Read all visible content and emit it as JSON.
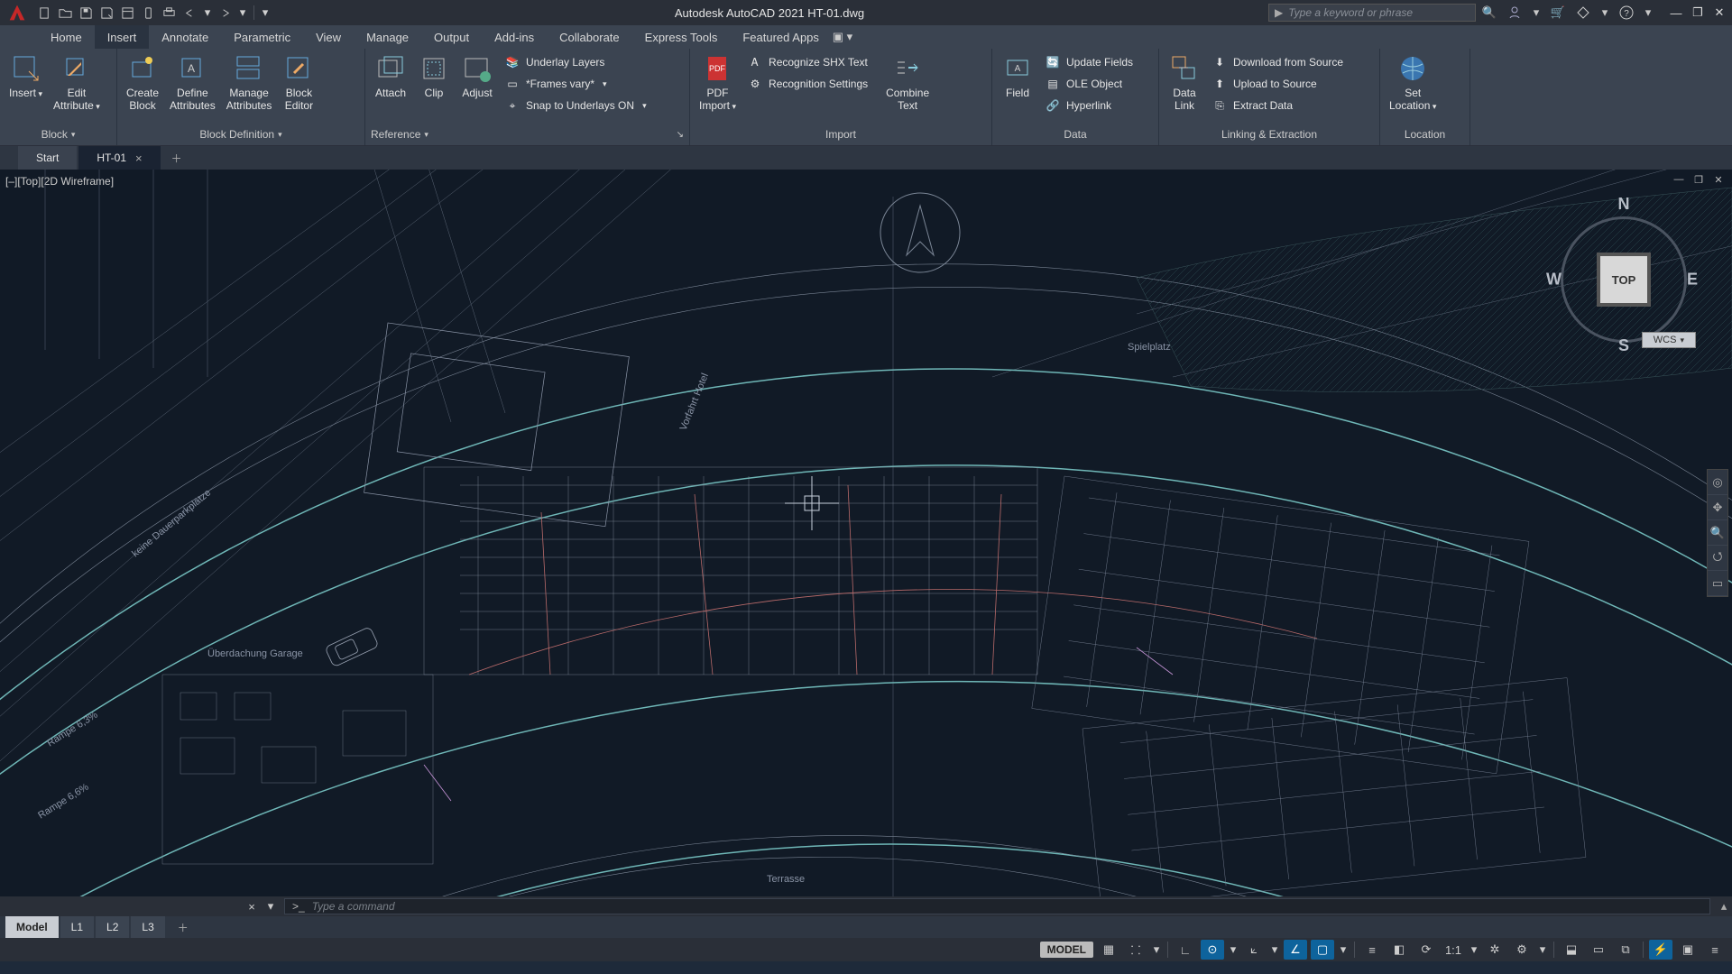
{
  "app": {
    "title": "Autodesk AutoCAD 2021   HT-01.dwg",
    "search_placeholder": "Type a keyword or phrase"
  },
  "menubar": [
    "Home",
    "Insert",
    "Annotate",
    "Parametric",
    "View",
    "Manage",
    "Output",
    "Add-ins",
    "Collaborate",
    "Express Tools",
    "Featured Apps"
  ],
  "menubar_active": "Insert",
  "ribbon": {
    "block": {
      "footer": "Block",
      "items": [
        {
          "label": "Insert",
          "dd": true
        },
        {
          "label": "Edit\nAttribute",
          "dd": true
        }
      ]
    },
    "blockdef": {
      "footer": "Block Definition",
      "items": [
        {
          "label": "Create\nBlock",
          "dd": false
        },
        {
          "label": "Define\nAttributes",
          "dd": false
        },
        {
          "label": "Manage\nAttributes",
          "dd": false
        },
        {
          "label": "Block\nEditor",
          "dd": false
        }
      ]
    },
    "reference": {
      "footer": "Reference",
      "big": [
        {
          "label": "Attach"
        },
        {
          "label": "Clip"
        },
        {
          "label": "Adjust"
        }
      ],
      "small": [
        {
          "label": "Underlay Layers"
        },
        {
          "label": "*Frames vary*",
          "dd": true
        },
        {
          "label": "Snap to Underlays ON",
          "dd": true
        }
      ]
    },
    "import": {
      "footer": "Import",
      "big": [
        {
          "label": "PDF\nImport",
          "dd": true
        }
      ],
      "small": [
        {
          "label": "Recognize SHX Text"
        },
        {
          "label": "Recognition Settings"
        }
      ],
      "combine": {
        "label": "Combine\nText"
      }
    },
    "data": {
      "footer": "Data",
      "big": [
        {
          "label": "Field"
        }
      ],
      "small": [
        {
          "label": "Update Fields"
        },
        {
          "label": "OLE Object"
        },
        {
          "label": "Hyperlink"
        }
      ]
    },
    "linking": {
      "footer": "Linking & Extraction",
      "big": [
        {
          "label": "Data\nLink"
        }
      ],
      "small": [
        {
          "label": "Download from Source"
        },
        {
          "label": "Upload to Source"
        },
        {
          "label": "Extract  Data"
        }
      ]
    },
    "location": {
      "footer": "Location",
      "big": [
        {
          "label": "Set\nLocation",
          "dd": true
        }
      ]
    }
  },
  "doctabs": [
    {
      "label": "Start",
      "closable": false,
      "active": false
    },
    {
      "label": "HT-01",
      "closable": true,
      "active": true
    }
  ],
  "viewport": {
    "label": "[–][Top][2D Wireframe]",
    "navcube": {
      "face": "TOP",
      "wcs": "WCS",
      "dirs": {
        "n": "N",
        "s": "S",
        "e": "E",
        "w": "W"
      }
    }
  },
  "drawing_text": {
    "garage": "Überdachung Garage",
    "hotel": "Vorfahrt Hotel",
    "ramp1": "Rampe 6,3%",
    "ramp2": "Rampe 6,6%",
    "parking": "keine Dauerparkplätze",
    "terrace": "Terrasse",
    "spiel": "Spielplatz"
  },
  "command": {
    "placeholder": "Type a command",
    "prompt": ">_"
  },
  "layout_tabs": [
    "Model",
    "L1",
    "L2",
    "L3"
  ],
  "status": {
    "model": "MODEL",
    "scale": "1:1"
  }
}
